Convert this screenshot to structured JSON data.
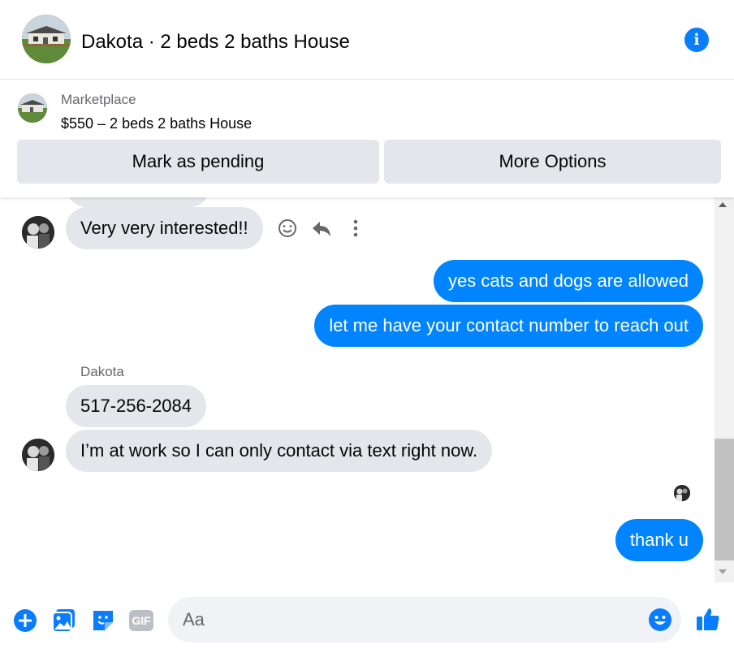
{
  "header": {
    "title": "Dakota · 2 beds 2 baths House",
    "avatar_icon": "house-photo-avatar",
    "info_icon": "info-icon",
    "info_glyph": "i"
  },
  "marketplace": {
    "label": "Marketplace",
    "listing": "$550 – 2 beds 2 baths House",
    "buttons": {
      "pending": "Mark as pending",
      "more": "More Options"
    }
  },
  "messages": [
    {
      "from": "them",
      "text": "Very very interested!!"
    },
    {
      "from": "me",
      "text": "yes cats and dogs are allowed"
    },
    {
      "from": "me",
      "text": "let me have your contact number to reach out"
    },
    {
      "from": "them",
      "sender": "Dakota",
      "text": "517-256-2084"
    },
    {
      "from": "them",
      "text": "I’m at work so I can only contact via text right now."
    },
    {
      "from": "me",
      "text": "thank u"
    }
  ],
  "message_actions": [
    "react-icon",
    "reply-icon",
    "more-icon"
  ],
  "composer": {
    "placeholder": "Aa",
    "icons": [
      "plus-icon",
      "photo-icon",
      "sticker-icon",
      "gif-icon",
      "emoji-icon",
      "thumbs-up-icon"
    ],
    "gif_label": "GIF"
  },
  "colors": {
    "accent": "#0084ff",
    "incoming_bubble": "#e4e6eb",
    "icon_blue": "#0a7cff"
  }
}
